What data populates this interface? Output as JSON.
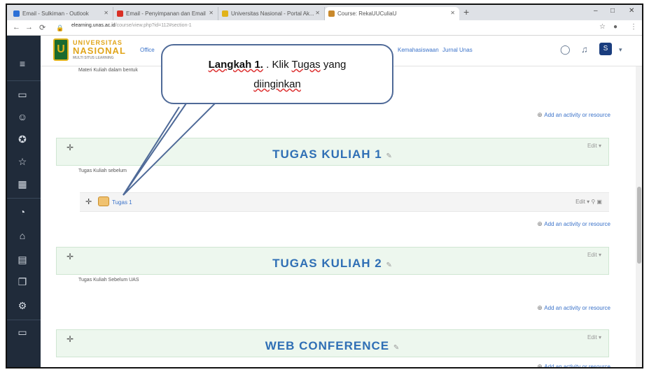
{
  "browser": {
    "tabs": [
      {
        "label": "Email - Sulkiman - Outlook",
        "color": "#2b6fd6"
      },
      {
        "label": "Email - Penyimpanan dan Email",
        "color": "#d93025"
      },
      {
        "label": "Universitas Nasional - Portal Ak...",
        "color": "#e1b31a"
      },
      {
        "label": "Course: RekaUUCuliaU",
        "color": "#c9892c"
      }
    ],
    "url_host": "elearning.unas.ac.id",
    "url_path": "/course/view.php?id=112#section-1",
    "new_tab": "+",
    "win_min": "–",
    "win_max": "□",
    "win_close": "✕"
  },
  "header": {
    "logo_glyph": "U",
    "logo_line1": "UNIVERSITAS",
    "logo_line2": "NASIONAL",
    "logo_line3": "MULTI SITUS LEARNING",
    "nav_left": "Office",
    "nav_right_1": "Kemahasiswaan",
    "nav_right_2": "Jurnal Unas",
    "avatar": "S"
  },
  "content": {
    "intro_text": "Materi Kuliah dalam bentuk",
    "add_activity": "Add an activity or resource",
    "sections": [
      {
        "title": "TUGAS KULIAH 1",
        "summary": "Tugas Kuliah sebelum"
      },
      {
        "title": "TUGAS KULIAH 2",
        "summary": "Tugas Kuliah Sebelum UAS"
      },
      {
        "title": "WEB CONFERENCE",
        "summary": ""
      }
    ],
    "edit_label": "Edit ▾",
    "activity": {
      "name": "Tugas 1",
      "edit": "Edit ▾"
    }
  },
  "callout": {
    "step": "Langkah 1.",
    "line1_rest": " . Klik ",
    "word_tugas": "Tugas",
    "line1_end": " yang",
    "line2": "diinginkan"
  }
}
